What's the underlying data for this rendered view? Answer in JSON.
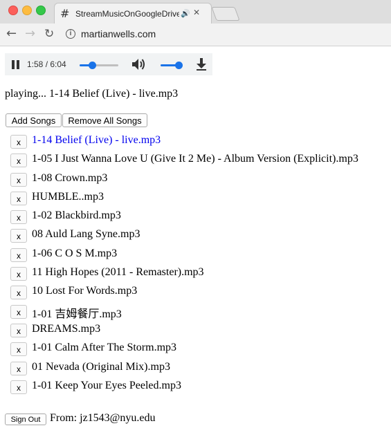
{
  "browser": {
    "tab_title": "StreamMusicOnGoogleDrive",
    "tab_favicon": "#",
    "tab_audio_icon": "🔊",
    "tab_close_icon": "✕",
    "url": "martianwells.com",
    "back_icon": "←",
    "forward_icon": "→",
    "reload_icon": "↻",
    "info_icon": "i"
  },
  "player": {
    "time_display": "1:58 / 6:04",
    "progress_fraction": 0.324,
    "volume_fraction": 0.85,
    "accent_color": "#1a73e8"
  },
  "now_playing": "playing... 1-14 Belief (Live) - live.mp3",
  "buttons": {
    "add_songs": "Add Songs",
    "remove_all": "Remove All Songs",
    "remove_song": "x",
    "sign_out": "Sign Out"
  },
  "songs": [
    {
      "title": "1-14 Belief (Live) - live.mp3",
      "active": true
    },
    {
      "title": "1-05 I Just Wanna Love U (Give It 2 Me) - Album Version (Explicit).mp3",
      "active": false
    },
    {
      "title": "1-08 Crown.mp3",
      "active": false
    },
    {
      "title": "HUMBLE..mp3",
      "active": false
    },
    {
      "title": "1-02 Blackbird.mp3",
      "active": false
    },
    {
      "title": "08 Auld Lang Syne.mp3",
      "active": false
    },
    {
      "title": "1-06 C O S M.mp3",
      "active": false
    },
    {
      "title": "11 High Hopes (2011 - Remaster).mp3",
      "active": false
    },
    {
      "title": "10 Lost For Words.mp3",
      "active": false
    },
    {
      "title": "1-01 吉姆餐厅.mp3",
      "active": false
    },
    {
      "title": "DREAMS.mp3",
      "active": false
    },
    {
      "title": "1-01 Calm After The Storm.mp3",
      "active": false
    },
    {
      "title": "01 Nevada (Original Mix).mp3",
      "active": false
    },
    {
      "title": "1-01 Keep Your Eyes Peeled.mp3",
      "active": false
    }
  ],
  "footer": {
    "from_text": "From: jz1543@nyu.edu"
  }
}
